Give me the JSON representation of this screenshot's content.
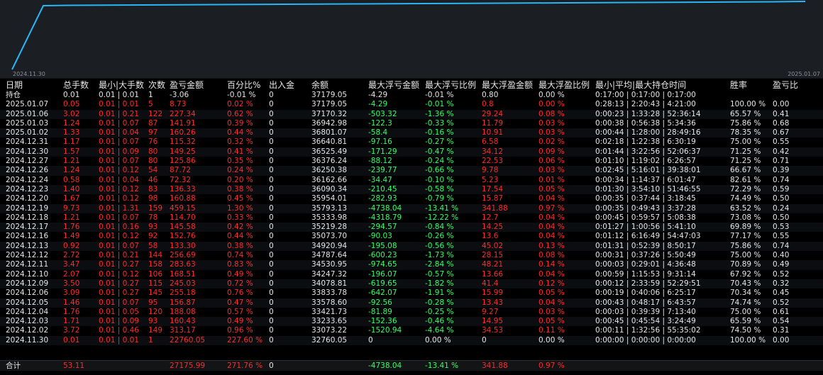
{
  "chart": {
    "start_label": "2024.11.30",
    "end_label": "2025.01.07",
    "line_color": "#29b6f6"
  },
  "headers": [
    "日期",
    "总手数",
    "最小|大手数",
    "次数",
    "盈亏金额",
    "百分比%",
    "出入金",
    "余额",
    "最大浮亏金额",
    "最大浮亏比例",
    "最大浮盈金额",
    "最大浮盈比例",
    "最小|平均|最大持仓时间",
    "胜率",
    "盈亏比"
  ],
  "holding": {
    "label": "持仓",
    "lots": "0.01",
    "minmax": "0.01 | 0.01",
    "count": "1",
    "pnl": "-3.06",
    "pct": "-0.01 %",
    "inout": "0",
    "balance": "37179.05",
    "max_float_loss": "-4.29",
    "max_float_loss_pct": "-0.01 %",
    "max_float_profit": "0.80",
    "max_float_profit_pct": "0.00 %",
    "hold_time": "0:17:00 | 0:17:00 | 0:17:00"
  },
  "rows": [
    {
      "date": "2025.01.07",
      "lots": "0.05",
      "minmax": "0.01 | 0.01",
      "count": "5",
      "pnl": "8.73",
      "pct": "0.02 %",
      "inout": "0",
      "balance": "37179.05",
      "mfl": "-4.29",
      "mflp": "-0.01 %",
      "mfp": "0.8",
      "mfpp": "0.00 %",
      "time": "0:28:13 | 2:20:43 | 4:21:00",
      "win": "100.00 %",
      "pl": "0.00"
    },
    {
      "date": "2025.01.06",
      "lots": "3.02",
      "minmax": "0.01 | 0.21",
      "count": "122",
      "pnl": "227.34",
      "pct": "0.62 %",
      "inout": "0",
      "balance": "37170.32",
      "mfl": "-503.32",
      "mflp": "-1.36 %",
      "mfp": "29.24",
      "mfpp": "0.08 %",
      "time": "0:00:23 | 1:33:28 | 52:36:14",
      "win": "65.57 %",
      "pl": "0.41"
    },
    {
      "date": "2025.01.03",
      "lots": "1.24",
      "minmax": "0.01 | 0.07",
      "count": "87",
      "pnl": "141.91",
      "pct": "0.39 %",
      "inout": "0",
      "balance": "36942.98",
      "mfl": "-122.3",
      "mflp": "-0.33 %",
      "mfp": "11.79",
      "mfpp": "0.03 %",
      "time": "0:00:38 | 0:56:38 | 5:34:36",
      "win": "75.86 %",
      "pl": "0.68"
    },
    {
      "date": "2025.01.02",
      "lots": "1.33",
      "minmax": "0.01 | 0.04",
      "count": "97",
      "pnl": "160.26",
      "pct": "0.44 %",
      "inout": "0",
      "balance": "36801.07",
      "mfl": "-58.4",
      "mflp": "-0.16 %",
      "mfp": "10.91",
      "mfpp": "0.03 %",
      "time": "0:00:44 | 1:28:00 | 28:49:16",
      "win": "78.35 %",
      "pl": "0.67"
    },
    {
      "date": "2024.12.31",
      "lots": "1.17",
      "minmax": "0.01 | 0.07",
      "count": "76",
      "pnl": "115.32",
      "pct": "0.32 %",
      "inout": "0",
      "balance": "36640.81",
      "mfl": "-97.16",
      "mflp": "-0.27 %",
      "mfp": "6.58",
      "mfpp": "0.02 %",
      "time": "0:02:18 | 1:22:38 | 6:30:19",
      "win": "75.00 %",
      "pl": "0.55"
    },
    {
      "date": "2024.12.30",
      "lots": "1.57",
      "minmax": "0.01 | 0.09",
      "count": "80",
      "pnl": "149.25",
      "pct": "0.41 %",
      "inout": "0",
      "balance": "36525.49",
      "mfl": "-171.29",
      "mflp": "-0.47 %",
      "mfp": "34.12",
      "mfpp": "0.09 %",
      "time": "0:01:44 | 3:22:56 | 52:06:37",
      "win": "71.25 %",
      "pl": "0.42"
    },
    {
      "date": "2024.12.27",
      "lots": "1.21",
      "minmax": "0.01 | 0.07",
      "count": "80",
      "pnl": "125.86",
      "pct": "0.35 %",
      "inout": "0",
      "balance": "36376.24",
      "mfl": "-88.12",
      "mflp": "-0.24 %",
      "mfp": "22.53",
      "mfpp": "0.06 %",
      "time": "0:01:10 | 1:19:02 | 6:26:57",
      "win": "71.25 %",
      "pl": "0.71"
    },
    {
      "date": "2024.12.26",
      "lots": "1.24",
      "minmax": "0.01 | 0.12",
      "count": "54",
      "pnl": "87.72",
      "pct": "0.24 %",
      "inout": "0",
      "balance": "36250.38",
      "mfl": "-239.77",
      "mflp": "-0.66 %",
      "mfp": "9.78",
      "mfpp": "0.03 %",
      "time": "0:02:45 | 5:16:01 | 39:38:01",
      "win": "66.67 %",
      "pl": "0.39"
    },
    {
      "date": "2024.12.24",
      "lots": "0.58",
      "minmax": "0.01 | 0.04",
      "count": "46",
      "pnl": "72.32",
      "pct": "0.20 %",
      "inout": "0",
      "balance": "36162.66",
      "mfl": "-34.47",
      "mflp": "-0.10 %",
      "mfp": "5.23",
      "mfpp": "0.01 %",
      "time": "0:00:34 | 1:14:37 | 6:01:47",
      "win": "82.61 %",
      "pl": "0.74"
    },
    {
      "date": "2024.12.23",
      "lots": "1.40",
      "minmax": "0.01 | 0.12",
      "count": "83",
      "pnl": "136.33",
      "pct": "0.38 %",
      "inout": "0",
      "balance": "36090.34",
      "mfl": "-210.45",
      "mflp": "-0.58 %",
      "mfp": "17.54",
      "mfpp": "0.05 %",
      "time": "0:01:30 | 3:54:10 | 51:46:55",
      "win": "72.29 %",
      "pl": "0.59"
    },
    {
      "date": "2024.12.20",
      "lots": "1.67",
      "minmax": "0.01 | 0.12",
      "count": "98",
      "pnl": "160.88",
      "pct": "0.45 %",
      "inout": "0",
      "balance": "35954.01",
      "mfl": "-282.93",
      "mflp": "-0.79 %",
      "mfp": "15.87",
      "mfpp": "0.04 %",
      "time": "0:00:35 | 0:37:44 | 3:18:45",
      "win": "74.49 %",
      "pl": "0.50"
    },
    {
      "date": "2024.12.19",
      "lots": "9.73",
      "minmax": "0.01 | 1.31",
      "count": "159",
      "pnl": "459.15",
      "pct": "1.30 %",
      "inout": "0",
      "balance": "35793.13",
      "mfl": "-4738.04",
      "mflp": "-13.41 %",
      "mfp": "341.88",
      "mfpp": "0.97 %",
      "time": "0:00:35 | 0:49:43 | 3:37:28",
      "win": "63.52 %",
      "pl": "0.24"
    },
    {
      "date": "2024.12.18",
      "lots": "1.21",
      "minmax": "0.01 | 0.07",
      "count": "78",
      "pnl": "114.70",
      "pct": "0.33 %",
      "inout": "0",
      "balance": "35333.98",
      "mfl": "-4318.79",
      "mflp": "-12.22 %",
      "mfp": "12.7",
      "mfpp": "0.04 %",
      "time": "0:00:45 | 0:59:57 | 5:08:38",
      "win": "73.08 %",
      "pl": "0.50"
    },
    {
      "date": "2024.12.17",
      "lots": "1.76",
      "minmax": "0.01 | 0.16",
      "count": "93",
      "pnl": "145.58",
      "pct": "0.42 %",
      "inout": "0",
      "balance": "35219.28",
      "mfl": "-294.57",
      "mflp": "-0.84 %",
      "mfp": "14.25",
      "mfpp": "0.04 %",
      "time": "0:01:27 | 1:00:56 | 5:41:10",
      "win": "69.89 %",
      "pl": "0.53"
    },
    {
      "date": "2024.12.16",
      "lots": "1.49",
      "minmax": "0.01 | 0.12",
      "count": "92",
      "pnl": "152.76",
      "pct": "0.44 %",
      "inout": "0",
      "balance": "35073.70",
      "mfl": "-90.03",
      "mflp": "-0.26 %",
      "mfp": "13.6",
      "mfpp": "0.04 %",
      "time": "0:01:12 | 6:16:49 | 54:47:03",
      "win": "77.17 %",
      "pl": "0.55"
    },
    {
      "date": "2024.12.13",
      "lots": "0.92",
      "minmax": "0.01 | 0.07",
      "count": "58",
      "pnl": "133.30",
      "pct": "0.38 %",
      "inout": "0",
      "balance": "34920.94",
      "mfl": "-195.08",
      "mflp": "-0.56 %",
      "mfp": "45.02",
      "mfpp": "0.13 %",
      "time": "0:01:31 | 0:52:39 | 8:50:17",
      "win": "75.86 %",
      "pl": "0.74"
    },
    {
      "date": "2024.12.12",
      "lots": "2.72",
      "minmax": "0.01 | 0.21",
      "count": "144",
      "pnl": "256.69",
      "pct": "0.74 %",
      "inout": "0",
      "balance": "34787.64",
      "mfl": "-600.23",
      "mflp": "-1.73 %",
      "mfp": "28.15",
      "mfpp": "0.08 %",
      "time": "0:00:31 | 0:37:26 | 5:50:49",
      "win": "75.00 %",
      "pl": "0.40"
    },
    {
      "date": "2024.12.11",
      "lots": "3.47",
      "minmax": "0.01 | 0.27",
      "count": "158",
      "pnl": "283.63",
      "pct": "0.83 %",
      "inout": "0",
      "balance": "34530.95",
      "mfl": "-974.65",
      "mflp": "-2.84 %",
      "mfp": "48.21",
      "mfpp": "0.14 %",
      "time": "0:00:03 | 0:29:01 | 4:36:48",
      "win": "70.89 %",
      "pl": "0.49"
    },
    {
      "date": "2024.12.10",
      "lots": "2.07",
      "minmax": "0.01 | 0.12",
      "count": "106",
      "pnl": "168.51",
      "pct": "0.49 %",
      "inout": "0",
      "balance": "34247.32",
      "mfl": "-196.07",
      "mflp": "-0.57 %",
      "mfp": "13.66",
      "mfpp": "0.04 %",
      "time": "0:00:59 | 1:15:53 | 9:31:14",
      "win": "67.92 %",
      "pl": "0.52"
    },
    {
      "date": "2024.12.09",
      "lots": "3.50",
      "minmax": "0.01 | 0.27",
      "count": "115",
      "pnl": "245.03",
      "pct": "0.72 %",
      "inout": "0",
      "balance": "34078.81",
      "mfl": "-619.65",
      "mflp": "-1.82 %",
      "mfp": "41.4",
      "mfpp": "0.12 %",
      "time": "0:00:12 | 2:33:59 | 52:29:51",
      "win": "70.43 %",
      "pl": "0.32"
    },
    {
      "date": "2024.12.06",
      "lots": "3.09",
      "minmax": "0.01 | 0.27",
      "count": "145",
      "pnl": "255.18",
      "pct": "0.76 %",
      "inout": "0",
      "balance": "33833.78",
      "mfl": "-642.07",
      "mflp": "-1.91 %",
      "mfp": "15.99",
      "mfpp": "0.05 %",
      "time": "0:00:19 | 0:40:06 | 6:25:17",
      "win": "70.34 %",
      "pl": "0.45"
    },
    {
      "date": "2024.12.05",
      "lots": "1.46",
      "minmax": "0.01 | 0.07",
      "count": "95",
      "pnl": "156.87",
      "pct": "0.47 %",
      "inout": "0",
      "balance": "33578.60",
      "mfl": "-92.56",
      "mflp": "-0.28 %",
      "mfp": "13.43",
      "mfpp": "0.04 %",
      "time": "0:00:43 | 0:48:17 | 6:43:57",
      "win": "74.74 %",
      "pl": "0.52"
    },
    {
      "date": "2024.12.04",
      "lots": "1.76",
      "minmax": "0.01 | 0.05",
      "count": "120",
      "pnl": "188.08",
      "pct": "0.57 %",
      "inout": "0",
      "balance": "33421.73",
      "mfl": "-81.89",
      "mflp": "-0.25 %",
      "mfp": "9.27",
      "mfpp": "0.03 %",
      "time": "0:00:03 | 0:39:39 | 7:13:40",
      "win": "75.00 %",
      "pl": "0.61"
    },
    {
      "date": "2024.12.03",
      "lots": "1.71",
      "minmax": "0.01 | 0.09",
      "count": "93",
      "pnl": "160.43",
      "pct": "0.49 %",
      "inout": "0",
      "balance": "33233.65",
      "mfl": "-152.36",
      "mflp": "-0.46 %",
      "mfp": "14.95",
      "mfpp": "0.05 %",
      "time": "0:00:45 | 0:45:54 | 3:24:49",
      "win": "65.59 %",
      "pl": "0.54"
    },
    {
      "date": "2024.12.02",
      "lots": "3.72",
      "minmax": "0.01 | 0.46",
      "count": "149",
      "pnl": "313.17",
      "pct": "0.96 %",
      "inout": "0",
      "balance": "33073.22",
      "mfl": "-1520.94",
      "mflp": "-4.64 %",
      "mfp": "34.53",
      "mfpp": "0.11 %",
      "time": "0:00:11 | 1:32:56 | 55:35:02",
      "win": "74.50 %",
      "pl": "0.31"
    },
    {
      "date": "2024.11.30",
      "lots": "0.01",
      "minmax": "0.01 | 0.01",
      "count": "1",
      "pnl": "22760.05",
      "pct": "227.60 %",
      "inout": "0",
      "balance": "32760.05",
      "mfl": "0",
      "mflp": "0.00 %",
      "mfp": "0",
      "mfpp": "0.00 %",
      "time": "0:00:00 | 0:00:00 | 0:00:00",
      "win": "100.00 %",
      "pl": "0.00"
    }
  ],
  "total": {
    "label": "合计",
    "lots": "53.11",
    "pnl": "27175.99",
    "pct": "271.76 %",
    "inout": "0",
    "mfl": "-4738.04",
    "mflp": "-13.41 %",
    "mfp": "341.88",
    "mfpp": "0.97 %"
  }
}
